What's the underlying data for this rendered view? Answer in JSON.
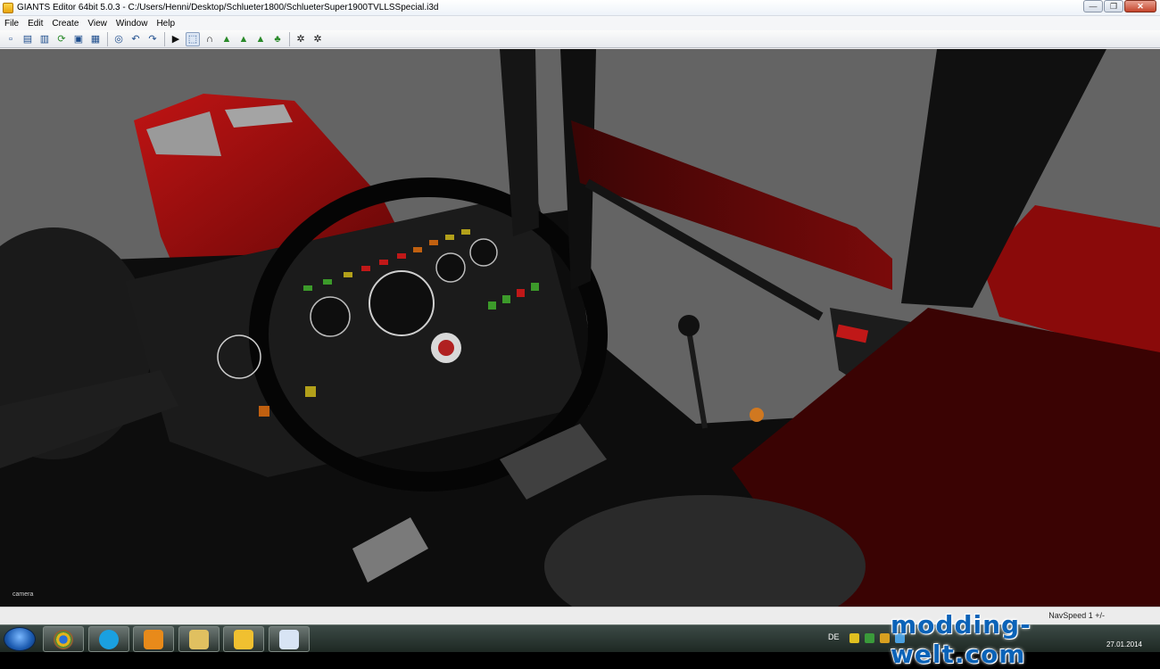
{
  "window": {
    "title": "GIANTS Editor 64bit 5.0.3 - C:/Users/Henni/Desktop/Schlueter1800/SchlueterSuper1900TVLLSSpecial.i3d",
    "minimize": "—",
    "maximize": "❐",
    "close": "✕"
  },
  "menu": {
    "items": [
      {
        "label": "File"
      },
      {
        "label": "Edit"
      },
      {
        "label": "Create"
      },
      {
        "label": "View"
      },
      {
        "label": "Window"
      },
      {
        "label": "Help"
      }
    ]
  },
  "toolbar": {
    "icons": [
      "new-icon",
      "open-icon",
      "recent-icon",
      "reload-icon",
      "save-icon",
      "save-as-icon",
      "object-icon",
      "undo-icon",
      "redo-icon",
      "play-icon",
      "select-icon",
      "move-icon",
      "terrain-paint-icon",
      "terrain-sculpt-icon",
      "foliage-paint-icon",
      "grass-icon",
      "settings-icon",
      "reset-icon"
    ]
  },
  "viewport": {
    "camera_label": "camera"
  },
  "statusbar": {
    "nav_speed": "NavSpeed 1 +/-"
  },
  "taskbar": {
    "apps": [
      "chrome",
      "skype",
      "media-player",
      "file-explorer",
      "giants-editor",
      "paint"
    ],
    "language": "DE",
    "time": "",
    "date": "27.01.2014"
  },
  "watermark": "modding-welt.com",
  "colors": {
    "tractor_red": "#8b0c0c",
    "sky_grey": "#636363",
    "titlebar": "#eef3f9",
    "watermark_blue": "#0b63b8"
  }
}
